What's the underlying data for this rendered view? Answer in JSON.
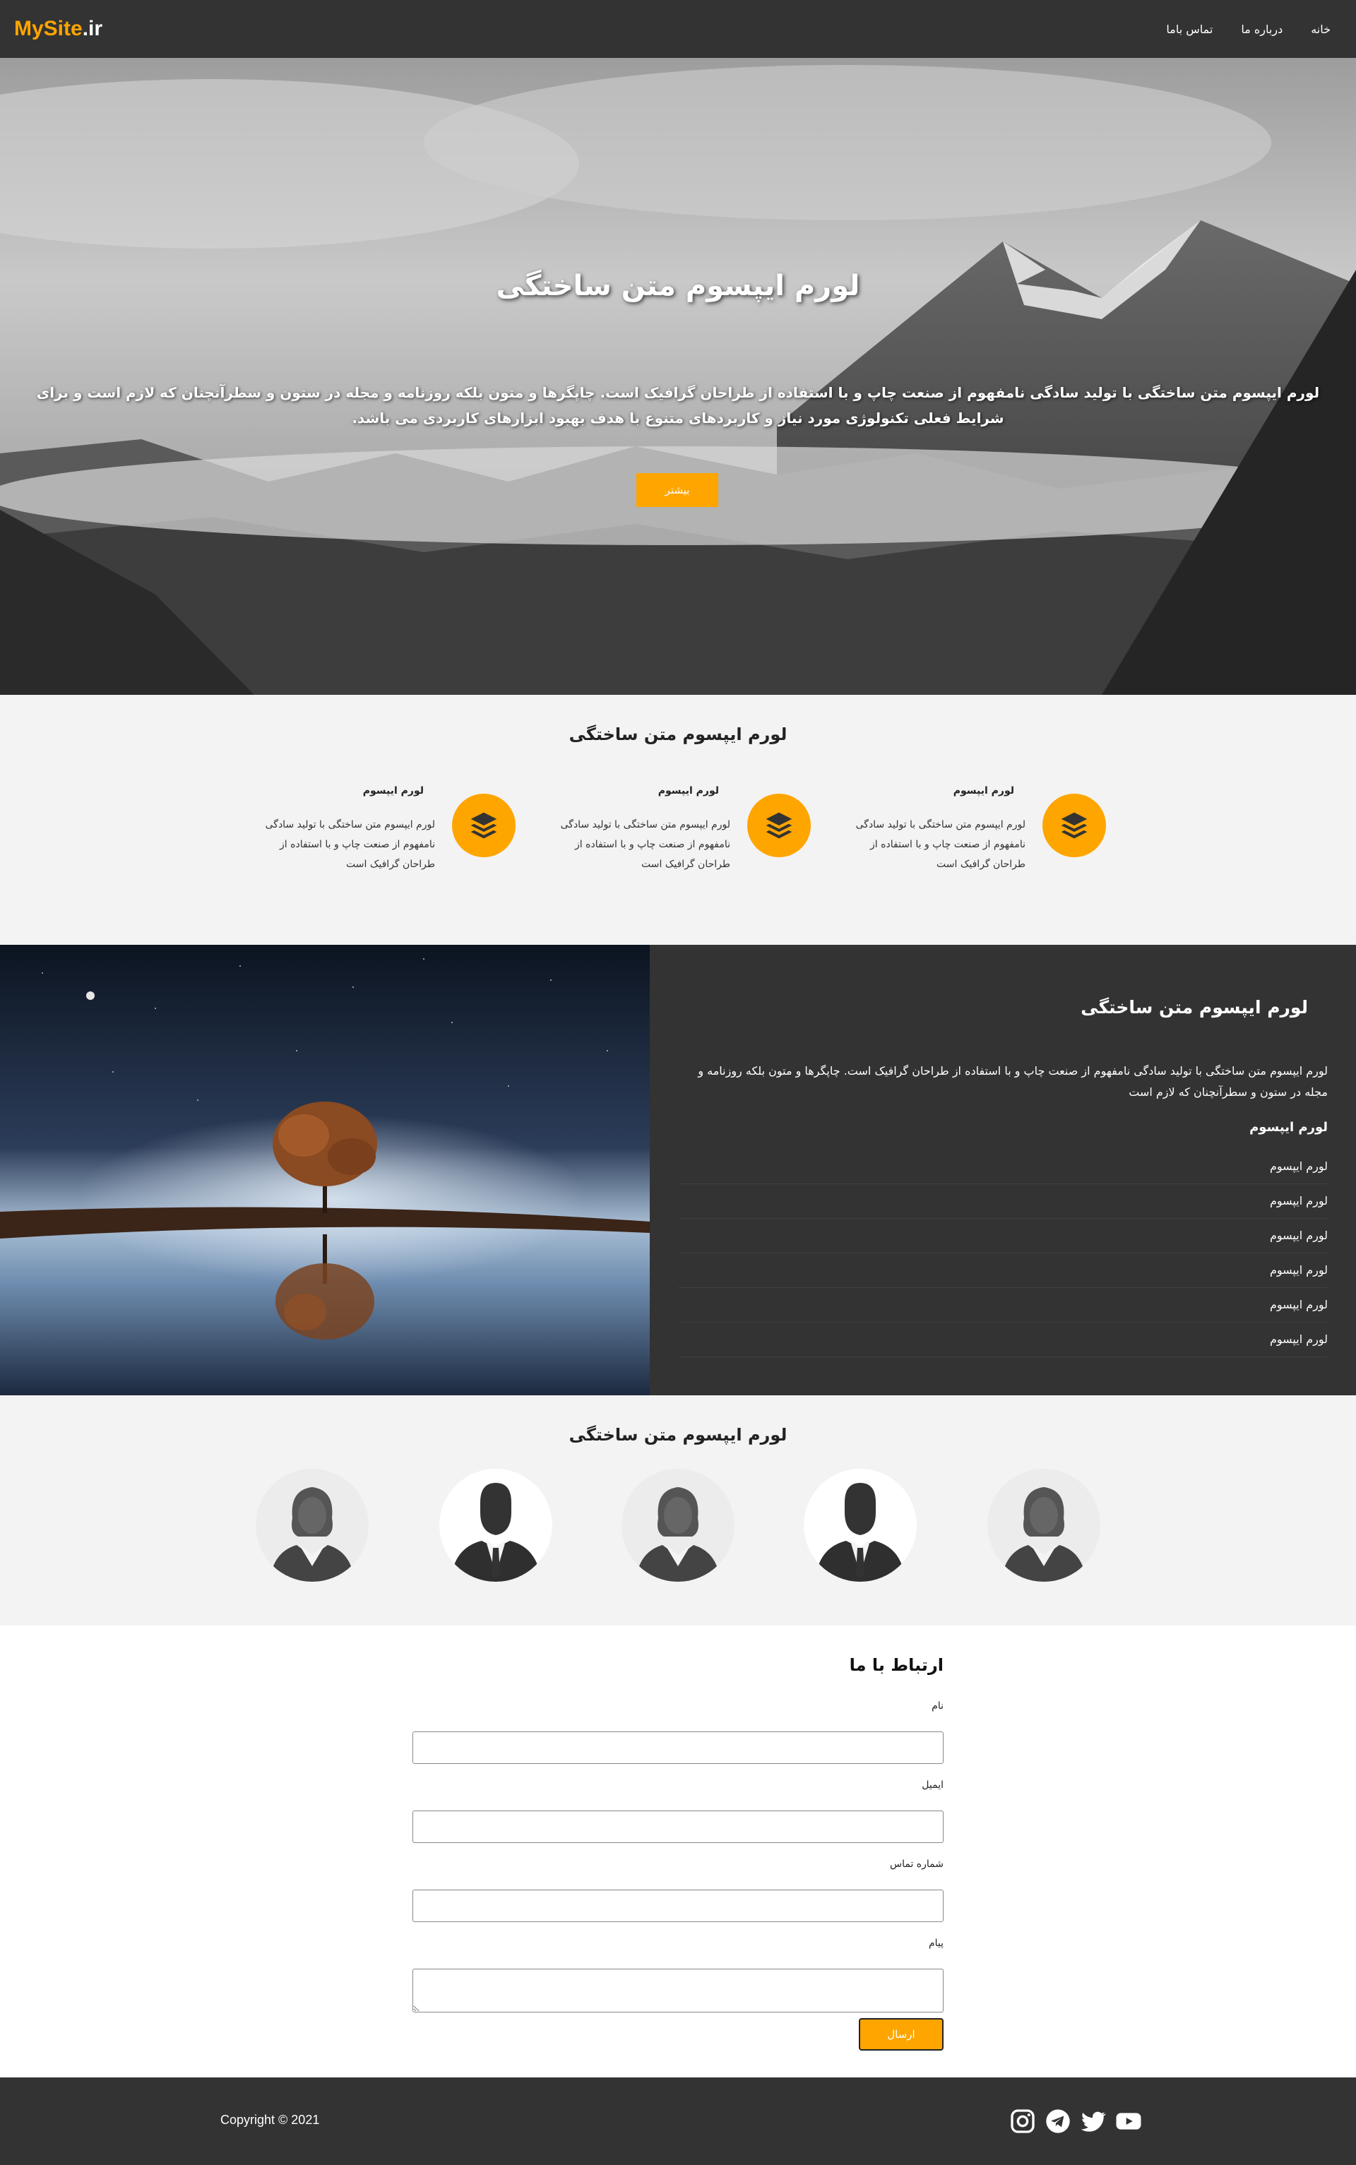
{
  "nav": {
    "logo_main": "MySite",
    "logo_ext": ".ir",
    "links": [
      "خانه",
      "درباره ما",
      "تماس باما"
    ]
  },
  "hero": {
    "title": "لورم ایپسوم متن ساختگی",
    "text": "لورم ایپسوم متن ساختگی با تولید سادگی نامفهوم از صنعت چاپ و با استفاده از طراحان گرافیک است. چاپگرها و متون بلکه روزنامه و مجله در ستون و سطرآنچنان که لازم است و برای شرایط فعلی تکنولوژی مورد نیاز و کاربردهای متنوع با هدف بهبود ابزارهای کاربردی می باشد.",
    "button": "بیشتر"
  },
  "services": {
    "title": "لورم ایپسوم متن ساختگی",
    "items": [
      {
        "title": "لورم ایپسوم",
        "text": "لورم ایپسوم متن ساختگی با تولید سادگی نامفهوم از صنعت چاپ و با استفاده از طراحان گرافیک است",
        "icon": "layers-icon"
      },
      {
        "title": "لورم ایپسوم",
        "text": "لورم ایپسوم متن ساختگی با تولید سادگی نامفهوم از صنعت چاپ و با استفاده از طراحان گرافیک است",
        "icon": "layers-icon"
      },
      {
        "title": "لورم ایپسوم",
        "text": "لورم ایپسوم متن ساختگی با تولید سادگی نامفهوم از صنعت چاپ و با استفاده از طراحان گرافیک است",
        "icon": "layers-icon"
      }
    ]
  },
  "split": {
    "title": "لورم ایپسوم متن ساختگی",
    "text": "لورم ایپسوم متن ساختگی با تولید سادگی نامفهوم از صنعت چاپ و با استفاده از طراحان گرافیک است. چاپگرها و متون بلکه روزنامه و مجله در ستون و سطرآنچنان که لازم است",
    "subtitle": "لورم ایپسوم",
    "list": [
      "لورم ایپسوم",
      "لورم ایپسوم",
      "لورم ایپسوم",
      "لورم ایپسوم",
      "لورم ایپسوم",
      "لورم ایپسوم"
    ]
  },
  "team": {
    "title": "لورم ایپسوم متن ساختگی",
    "members": [
      "female",
      "male",
      "female",
      "male",
      "female"
    ]
  },
  "contact": {
    "title": "ارتباط با ما",
    "name_label": "نام",
    "email_label": "ایمیل",
    "phone_label": "شماره تماس",
    "message_label": "پیام",
    "send": "ارسال"
  },
  "footer": {
    "copyright": "Copyright © 2021",
    "social": [
      "instagram-icon",
      "telegram-icon",
      "twitter-icon",
      "youtube-icon"
    ]
  },
  "colors": {
    "accent": "#ffa500",
    "dark": "#333333",
    "light_bg": "#f3f3f3"
  }
}
